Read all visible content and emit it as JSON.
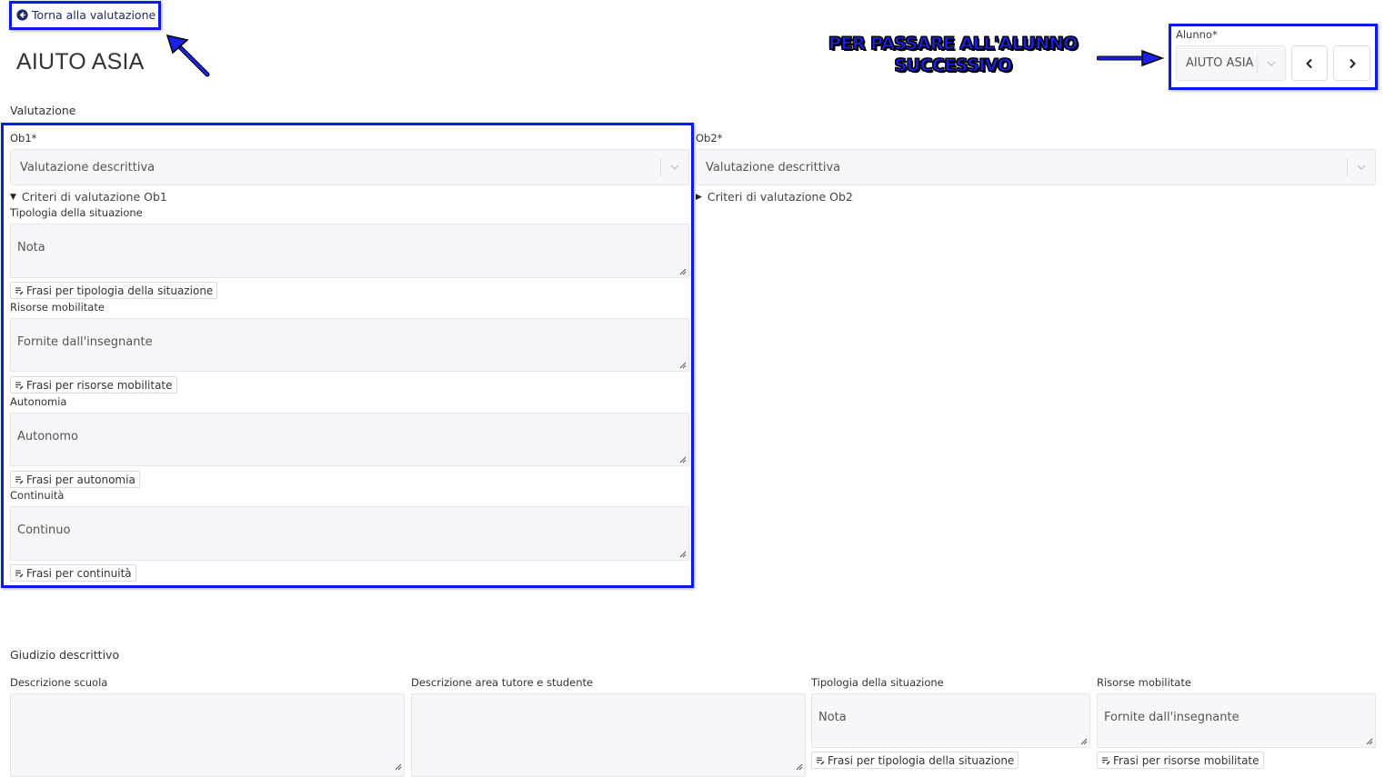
{
  "header": {
    "back_label": "Torna alla valutazione",
    "student_name": "AIUTO ASIA"
  },
  "annotation": {
    "line1": "PER PASSARE ALL'ALUNNO",
    "line2": "SUCCESSIVO",
    "color": "#0b1be6"
  },
  "student_selector": {
    "label": "Alunno*",
    "value": "AIUTO ASIA",
    "prev_icon": "chevron-left-icon",
    "next_icon": "chevron-right-icon"
  },
  "valutazione": {
    "title": "Valutazione",
    "ob1": {
      "label": "Ob1*",
      "select_value": "Valutazione descrittiva",
      "criteria_toggle": "Criteri di valutazione Ob1",
      "expanded": true,
      "fields": [
        {
          "label": "Tipologia della situazione",
          "value": "Nota",
          "button": "Frasi per tipologia della situazione"
        },
        {
          "label": "Risorse mobilitate",
          "value": "Fornite dall'insegnante",
          "button": "Frasi per risorse mobilitate"
        },
        {
          "label": "Autonomia",
          "value": "Autonomo",
          "button": "Frasi per autonomia"
        },
        {
          "label": "Continuità",
          "value": "Continuo",
          "button": "Frasi per continuità"
        }
      ]
    },
    "ob2": {
      "label": "Ob2*",
      "select_value": "Valutazione descrittiva",
      "criteria_toggle": "Criteri di valutazione Ob2",
      "expanded": false
    }
  },
  "giudizio": {
    "title": "Giudizio descrittivo",
    "fields": [
      {
        "label": "Descrizione scuola",
        "value": ""
      },
      {
        "label": "Descrizione area tutore e studente",
        "value": ""
      },
      {
        "label": "Tipologia della situazione",
        "value": "Nota",
        "button": "Frasi per tipologia della situazione"
      },
      {
        "label": "Risorse mobilitate",
        "value": "Fornite dall'insegnante",
        "button": "Frasi per risorse mobilitate"
      }
    ]
  },
  "colors": {
    "link": "#1f2a6b",
    "field_bg": "#f7f7f9",
    "field_border": "#e6e6ea"
  }
}
